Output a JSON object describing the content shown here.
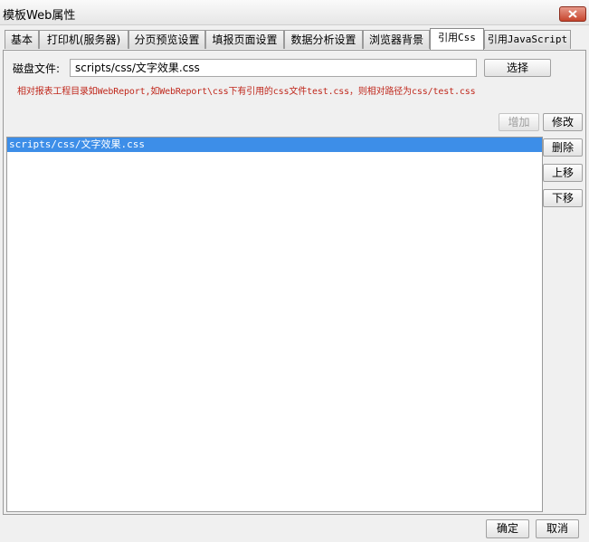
{
  "window": {
    "title": "模板Web属性"
  },
  "tabs": [
    {
      "label": "基本"
    },
    {
      "label": "打印机(服务器)"
    },
    {
      "label": "分页预览设置"
    },
    {
      "label": "填报页面设置"
    },
    {
      "label": "数据分析设置"
    },
    {
      "label": "浏览器背景"
    },
    {
      "label": "引用Css",
      "active": true
    },
    {
      "label": "引用JavaScript"
    }
  ],
  "css_tab": {
    "disk_file_label": "磁盘文件:",
    "disk_file_value": "scripts/css/文字效果.css",
    "select_button": "选择",
    "hint": "相对报表工程目录如WebReport,如WebReport\\css下有引用的css文件test.css，则相对路径为css/test.css",
    "add_button": "增加",
    "modify_button": "修改",
    "delete_button": "删除",
    "move_up_button": "上移",
    "move_down_button": "下移",
    "files": [
      "scripts/css/文字效果.css"
    ]
  },
  "footer": {
    "ok": "确定",
    "cancel": "取消"
  },
  "colors": {
    "hint": "#c0281c",
    "selection": "#3d8ee8",
    "close_button": "#c7452d"
  }
}
